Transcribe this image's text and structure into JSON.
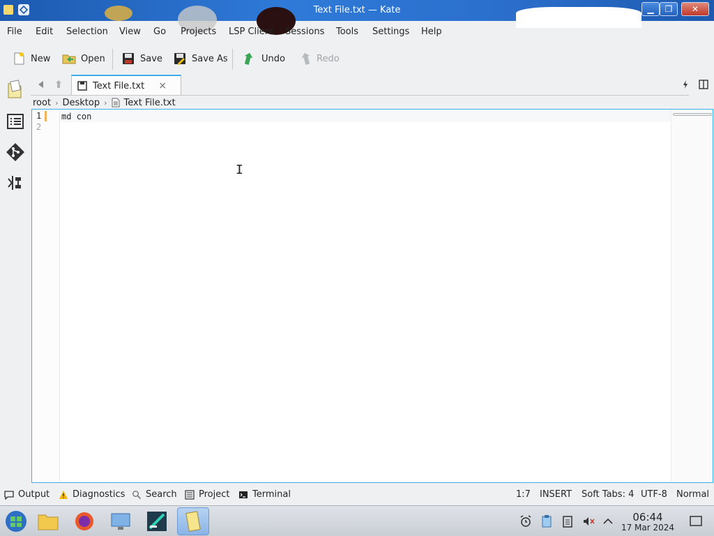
{
  "window": {
    "title": "Text File.txt  —  Kate"
  },
  "menu": [
    "File",
    "Edit",
    "Selection",
    "View",
    "Go",
    "Projects",
    "LSP Client",
    "Sessions",
    "Tools",
    "Settings",
    "Help"
  ],
  "toolbar": {
    "new": "New",
    "open": "Open",
    "save": "Save",
    "save_as": "Save As",
    "undo": "Undo",
    "redo": "Redo"
  },
  "tab": {
    "label": "Text File.txt",
    "close": "×"
  },
  "breadcrumb": [
    "root",
    "Desktop",
    "Text File.txt"
  ],
  "editor": {
    "lines": [
      "1",
      "2"
    ],
    "content": "md con"
  },
  "bottom_tabs": [
    "Output",
    "Diagnostics",
    "Search",
    "Project",
    "Terminal"
  ],
  "status": {
    "position": "1:7",
    "mode": "INSERT",
    "indent": "Soft Tabs: 4",
    "encoding": "UTF-8",
    "input_mode": "Normal"
  },
  "clock": {
    "time": "06:44",
    "date": "17 Mar 2024"
  },
  "colors": {
    "accent": "#3daee9",
    "title_blue": "#2b6fcc",
    "modified_marker": "#f4b35a"
  },
  "icons": {
    "new": "new-document-icon",
    "open": "folder-open-icon",
    "save": "floppy-icon",
    "save_as": "floppy-pencil-icon",
    "undo": "undo-arrow-icon",
    "redo": "redo-arrow-icon"
  }
}
